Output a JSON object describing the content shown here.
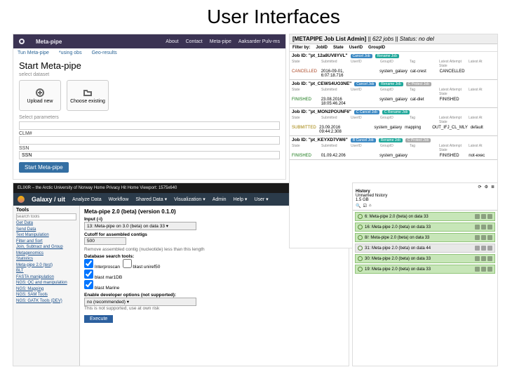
{
  "title": "User Interfaces",
  "metapipe": {
    "brand": "Meta-pipe",
    "nav": [
      "About",
      "Contact",
      "Meta-pipe",
      "Aaksarder Pulv-ms"
    ],
    "tabs": [
      "Tun Meta-pipe",
      "*using obs",
      "Geo-results"
    ],
    "heading": "Start Meta-pipe",
    "select_dataset": "select dataset",
    "upload": "Upload new",
    "existing": "Choose existing",
    "select_params": "Select parameters",
    "p1_label": "CLM#",
    "p1_value": "",
    "p2_label": "SSN",
    "p2_value": "SSN",
    "start": "Start Meta-pipe"
  },
  "galaxy": {
    "blackbar": "ELIXIR – the Arctic University of Norway   Home   Privacy   Hit Home    Viewport: 1575x640",
    "brand": "Galaxy / uit",
    "nav": [
      "Analyze Data",
      "Workflow",
      "Shared Data ▾",
      "Visualization ▾",
      "Admin",
      "Help ▾",
      "User ▾"
    ],
    "tools_hdr": "Tools",
    "search_ph": "search tools",
    "links": [
      "Get Data",
      "Send Data",
      "Text Manipulation",
      "Filter and Sort",
      "Join, Subtract and Group",
      "Metagenomics",
      "Statistics",
      "Meta-pipe 2.0 (test)",
      "BLT",
      "FASTA manipulation",
      "NGS: QC and manipulation",
      "NGS: Mapping",
      "NGS: SAM Tools",
      "NGS: GATK Tools (DEV)"
    ],
    "tool_title": "Meta-pipe 2.0 (beta) (version 0.1.0)",
    "f_input_l": "Input (-i)",
    "f_input_v": "13: Meta-pipe on 3.0 (beta) on data 33  ▾",
    "f_cutoff_l": "Cutoff for assembled contigs",
    "f_cutoff_v": "500",
    "f_remove": "Remove assembled contig (nucleotide) less than this length",
    "f_db_l": "Database search tools:",
    "f_db_1": "Interproscan",
    "f_db_2": "blast uniref50",
    "f_db_3": "blast mar1DB",
    "f_db_4": "blast Marine",
    "f_dev_l": "Enable developer options (not supported):",
    "f_dev_v": "no (recommended) ▾",
    "f_dev_h": "This is not supported, use at own risk",
    "exec": "Execute"
  },
  "jobadmin": {
    "title_pre": "[METAPIPE Job List Admin]",
    "title_mid": " || 622 jobs || ",
    "title_post": "Status: no del",
    "filter_l": "Filter by:",
    "filters": [
      "JobID",
      "State",
      "UserID",
      "GroupID"
    ],
    "jobs": [
      {
        "id": "Job ID: \"pt_12a8UV8YVL\"",
        "pills": [
          "Cancel Job",
          "Rename Job"
        ],
        "cols": [
          "State",
          "Submitted",
          "UserID",
          "GroupID",
          "Tag",
          "Latest Attempt State",
          "Latest At"
        ],
        "vals": [
          "CANCELLED",
          "2016-09-01, 6:07:18.716",
          "",
          "system_galaxy",
          "cat-crest",
          "CANCELLED",
          ""
        ]
      },
      {
        "id": "Job ID: \"pt_CEWS4UO3NE\"",
        "pills": [
          "Cancel Job",
          "Rename Job",
          "C Protect Job"
        ],
        "cols": [
          "State",
          "Submitted",
          "UserID",
          "GroupID",
          "Tag",
          "Latest Attempt State",
          "Latest At"
        ],
        "vals": [
          "FINISHED",
          "23.08.2016 18:05:46.204",
          "",
          "system_galaxy",
          "cat-diet",
          "FINISHED",
          ""
        ]
      },
      {
        "id": "Job ID: \"pt_MON2POUNF6\"",
        "pills": [
          "C Cancel Job",
          "C Rename Job"
        ],
        "cols": [
          "State",
          "Submitted",
          "UserID",
          "GroupID",
          "Tag",
          "Latest Attempt State",
          "Latest At"
        ],
        "vals": [
          "SUBMITTED",
          "23.09.2016 09:44:2.308",
          "",
          "system_galaxy",
          "mapping",
          "OUT_IFJ_CL_MLY",
          "default"
        ]
      },
      {
        "id": "Job ID: \"pt_KEYXD7VW6\"",
        "pills": [
          "B Cancel Job",
          "Rename Job",
          "C Protect Job"
        ],
        "cols": [
          "State",
          "Submitted",
          "UserID",
          "GroupID",
          "Tag",
          "Latest Attempt State",
          "Latest At"
        ],
        "vals": [
          "FINISHED",
          "01.09.42.206",
          "",
          "system_galaxy",
          "",
          "FINISHED",
          "not-exec"
        ]
      }
    ]
  },
  "history": {
    "header": "History",
    "title": "Unnamed history",
    "size": "1.5 GB",
    "items": [
      {
        "n": "6: Meta-pipe 2.0 (beta) on data 33",
        "g": true
      },
      {
        "n": "16: Meta-pipe 2.0 (beta) on data 33",
        "g": true
      },
      {
        "n": "8/: Meta-pipe 2.0 (beta) on data 33",
        "g": true
      },
      {
        "n": "31: Meta-pipe 2.0 (beta) on data 44",
        "g": false
      },
      {
        "n": "30: Meta-pipe 2.0 (beta) on data 33",
        "g": true
      },
      {
        "n": "19: Meta-pipe 2.0 (beta) on data 33",
        "g": true
      }
    ]
  }
}
